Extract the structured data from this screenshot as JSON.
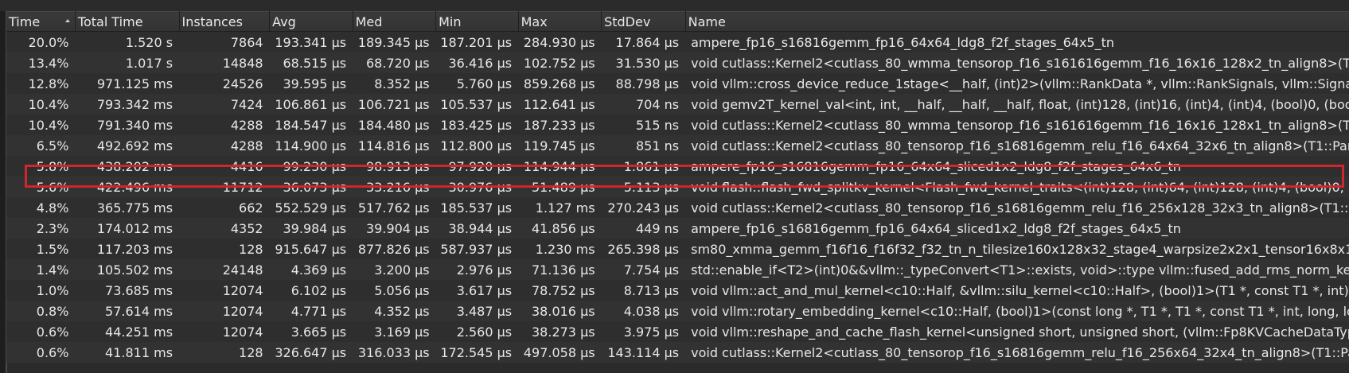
{
  "columns": {
    "time": "Time",
    "total_time": "Total Time",
    "instances": "Instances",
    "avg": "Avg",
    "med": "Med",
    "min": "Min",
    "max": "Max",
    "stddev": "StdDev",
    "name": "Name"
  },
  "sort": {
    "column": "Time",
    "direction": "ascending-indicator"
  },
  "rows": [
    {
      "time": "20.0%",
      "total": "1.520 s",
      "instances": "7864",
      "avg": "193.341 µs",
      "med": "189.345 µs",
      "min": "187.201 µs",
      "max": "284.930 µs",
      "std": "17.864 µs",
      "name": "ampere_fp16_s16816gemm_fp16_64x64_ldg8_f2f_stages_64x5_tn"
    },
    {
      "time": "13.4%",
      "total": "1.017 s",
      "instances": "14848",
      "avg": "68.515 µs",
      "med": "68.720 µs",
      "min": "36.416 µs",
      "max": "102.752 µs",
      "std": "31.530 µs",
      "name": "void cutlass::Kernel2<cutlass_80_wmma_tensorop_f16_s161616gemm_f16_16x16_128x2_tn_align8>(T"
    },
    {
      "time": "12.8%",
      "total": "971.125 ms",
      "instances": "24526",
      "avg": "39.595 µs",
      "med": "8.352 µs",
      "min": "5.760 µs",
      "max": "859.268 µs",
      "std": "88.798 µs",
      "name": "void vllm::cross_device_reduce_1stage<__half, (int)2>(vllm::RankData *, vllm::RankSignals, vllm::Signa"
    },
    {
      "time": "10.4%",
      "total": "793.342 ms",
      "instances": "7424",
      "avg": "106.861 µs",
      "med": "106.721 µs",
      "min": "105.537 µs",
      "max": "112.641 µs",
      "std": "704 ns",
      "name": "void gemv2T_kernel_val<int, int, __half, __half, __half, float, (int)128, (int)16, (int)4, (int)4, (bool)0, (boo"
    },
    {
      "time": "10.4%",
      "total": "791.340 ms",
      "instances": "4288",
      "avg": "184.547 µs",
      "med": "184.480 µs",
      "min": "183.425 µs",
      "max": "187.233 µs",
      "std": "515 ns",
      "name": "void cutlass::Kernel2<cutlass_80_wmma_tensorop_f16_s161616gemm_f16_16x16_128x1_tn_align8>(T"
    },
    {
      "time": "6.5%",
      "total": "492.692 ms",
      "instances": "4288",
      "avg": "114.900 µs",
      "med": "114.816 µs",
      "min": "112.800 µs",
      "max": "119.745 µs",
      "std": "851 ns",
      "name": "void cutlass::Kernel2<cutlass_80_tensorop_f16_s16816gemm_relu_f16_64x64_32x6_tn_align8>(T1::Par"
    },
    {
      "time": "5.8%",
      "total": "438.202 ms",
      "instances": "4416",
      "avg": "99.230 µs",
      "med": "98.913 µs",
      "min": "97.920 µs",
      "max": "114.944 µs",
      "std": "1.861 µs",
      "name": "ampere_fp16_s16816gemm_fp16_64x64_sliced1x2_ldg8_f2f_stages_64x6_tn"
    },
    {
      "time": "5.6%",
      "total": "422.496 ms",
      "instances": "11712",
      "avg": "36.073 µs",
      "med": "33.216 µs",
      "min": "30.976 µs",
      "max": "51.489 µs",
      "std": "5.113 µs",
      "name": "void flash::flash_fwd_splitkv_kernel<Flash_fwd_kernel_traits<(int)128, (int)64, (int)128, (int)4, (bool)0, (b"
    },
    {
      "time": "4.8%",
      "total": "365.775 ms",
      "instances": "662",
      "avg": "552.529 µs",
      "med": "517.762 µs",
      "min": "185.537 µs",
      "max": "1.127 ms",
      "std": "270.243 µs",
      "name": "void cutlass::Kernel2<cutlass_80_tensorop_f16_s16816gemm_relu_f16_256x128_32x3_tn_align8>(T1::P"
    },
    {
      "time": "2.3%",
      "total": "174.012 ms",
      "instances": "4352",
      "avg": "39.984 µs",
      "med": "39.904 µs",
      "min": "38.944 µs",
      "max": "41.856 µs",
      "std": "449 ns",
      "name": "ampere_fp16_s16816gemm_fp16_64x64_sliced1x2_ldg8_f2f_stages_64x5_tn"
    },
    {
      "time": "1.5%",
      "total": "117.203 ms",
      "instances": "128",
      "avg": "915.647 µs",
      "med": "877.826 µs",
      "min": "587.937 µs",
      "max": "1.230 ms",
      "std": "265.398 µs",
      "name": "sm80_xmma_gemm_f16f16_f16f32_f32_tn_n_tilesize160x128x32_stage4_warpsize2x2x1_tensor16x8x1"
    },
    {
      "time": "1.4%",
      "total": "105.502 ms",
      "instances": "24148",
      "avg": "4.369 µs",
      "med": "3.200 µs",
      "min": "2.976 µs",
      "max": "71.136 µs",
      "std": "7.754 µs",
      "name": "std::enable_if<T2>(int)0&&vllm::_typeConvert<T1>::exists, void>::type vllm::fused_add_rms_norm_ke"
    },
    {
      "time": "1.0%",
      "total": "73.685 ms",
      "instances": "12074",
      "avg": "6.102 µs",
      "med": "5.056 µs",
      "min": "3.617 µs",
      "max": "78.752 µs",
      "std": "8.713 µs",
      "name": "void vllm::act_and_mul_kernel<c10::Half, &vllm::silu_kernel<c10::Half>, (bool)1>(T1 *, const T1 *, int)"
    },
    {
      "time": "0.8%",
      "total": "57.614 ms",
      "instances": "12074",
      "avg": "4.771 µs",
      "med": "4.352 µs",
      "min": "3.487 µs",
      "max": "38.016 µs",
      "std": "4.038 µs",
      "name": "void vllm::rotary_embedding_kernel<c10::Half, (bool)1>(const long *, T1 *, T1 *, const T1 *, int, long, lo"
    },
    {
      "time": "0.6%",
      "total": "44.251 ms",
      "instances": "12074",
      "avg": "3.665 µs",
      "med": "3.169 µs",
      "min": "2.560 µs",
      "max": "38.273 µs",
      "std": "3.975 µs",
      "name": "void vllm::reshape_and_cache_flash_kernel<unsigned short, unsigned short, (vllm::Fp8KVCacheDataTyp"
    },
    {
      "time": "0.6%",
      "total": "41.811 ms",
      "instances": "128",
      "avg": "326.647 µs",
      "med": "316.033 µs",
      "min": "172.545 µs",
      "max": "497.058 µs",
      "std": "143.114 µs",
      "name": "void cutlass::Kernel2<cutlass_80_tensorop_f16_s16816gemm_relu_f16_256x64_32x4_tn_align8>(T1::Pa"
    }
  ],
  "highlighted_row_index": 7,
  "colors": {
    "background": "#2b2b2b",
    "header": "#363636",
    "text": "#e8e8e8",
    "highlight_border": "#d1262b"
  }
}
